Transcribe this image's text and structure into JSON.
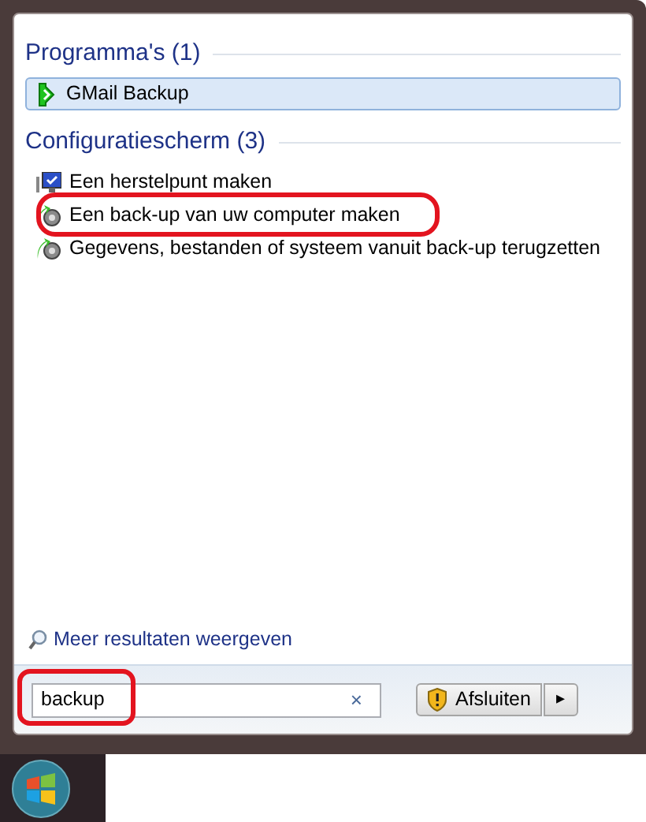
{
  "sections": [
    {
      "title": "Programma's (1)",
      "items": [
        {
          "label": "GMail Backup",
          "kind": "program",
          "selected": true,
          "highlighted": false
        }
      ]
    },
    {
      "title": "Configuratiescherm (3)",
      "items": [
        {
          "label": "Een herstelpunt maken",
          "kind": "monitor",
          "selected": false,
          "highlighted": false
        },
        {
          "label": "Een back-up van uw computer maken",
          "kind": "backup",
          "selected": false,
          "highlighted": true
        },
        {
          "label": "Gegevens, bestanden of systeem vanuit back-up terugzetten",
          "kind": "backup",
          "selected": false,
          "highlighted": false
        }
      ]
    }
  ],
  "more_results": "Meer resultaten weergeven",
  "search": {
    "value": "backup",
    "clear": "×",
    "highlighted": true
  },
  "shutdown": {
    "label": "Afsluiten",
    "arrow": "▸"
  }
}
